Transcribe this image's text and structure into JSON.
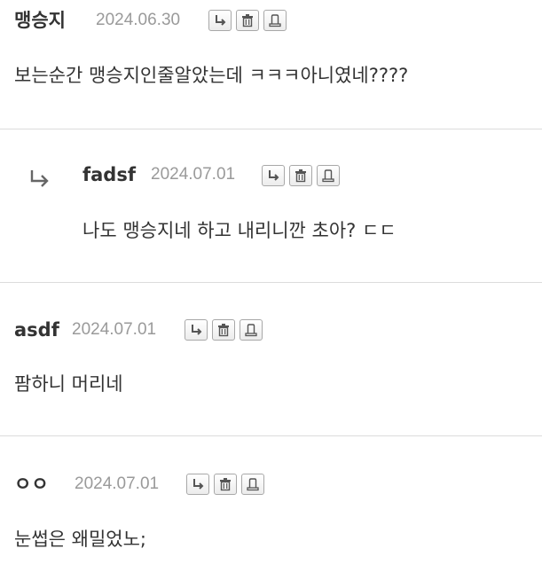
{
  "comments": [
    {
      "author": "맹승지",
      "date": "2024.06.30",
      "text": "보는순간 맹승지인줄알았는데 ㅋㅋㅋ아니였네????"
    },
    {
      "author": "fadsf",
      "date": "2024.07.01",
      "text": "나도 맹승지네 하고 내리니깐 초아? ㄷㄷ",
      "is_reply": true
    },
    {
      "author": "asdf",
      "date": "2024.07.01",
      "text": "팜하니 머리네"
    },
    {
      "author": "ㅇㅇ",
      "date": "2024.07.01",
      "text": "눈썹은 왜밀었노;"
    }
  ],
  "icons": {
    "reply": "reply-arrow-icon",
    "delete": "trash-icon",
    "report": "report-icon",
    "reply_indicator": "reply-indicator-icon"
  },
  "colors": {
    "text": "#333333",
    "date": "#9a9a9a",
    "divider": "#dcdcdc",
    "button_border": "#a8a8a8"
  }
}
